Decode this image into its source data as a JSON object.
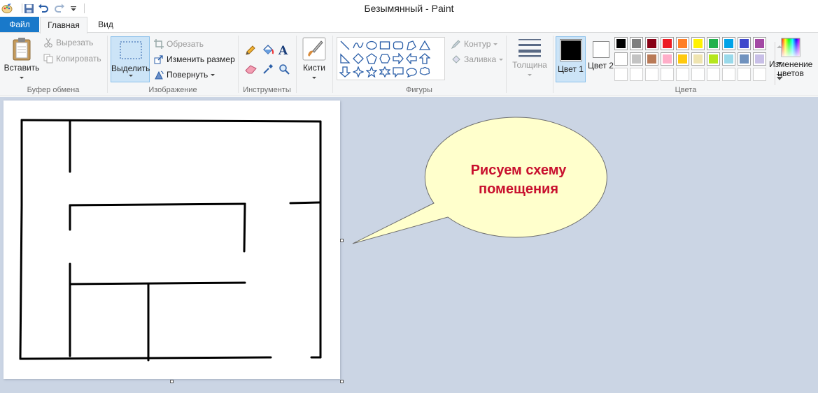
{
  "window": {
    "title": "Безымянный - Paint"
  },
  "tabs": {
    "file": "Файл",
    "home": "Главная",
    "view": "Вид"
  },
  "clipboard": {
    "paste": "Вставить",
    "cut": "Вырезать",
    "copy": "Копировать",
    "group": "Буфер обмена"
  },
  "image": {
    "select": "Выделить",
    "crop": "Обрезать",
    "resize": "Изменить размер",
    "rotate": "Повернуть",
    "group": "Изображение"
  },
  "tools": {
    "group": "Инструменты"
  },
  "brushes": {
    "label": "Кисти"
  },
  "shapes": {
    "outline": "Контур",
    "fill": "Заливка",
    "group": "Фигуры"
  },
  "size": {
    "label": "Толщина"
  },
  "colors": {
    "color1": "Цвет 1",
    "color2": "Цвет 2",
    "edit": "Изменение цветов",
    "group": "Цвета",
    "color1_value": "#000000",
    "color2_value": "#ffffff",
    "palette_row1": [
      "#000000",
      "#7f7f7f",
      "#880015",
      "#ed1c24",
      "#ff7f27",
      "#fff200",
      "#22b14c",
      "#00a2e8",
      "#3f48cc",
      "#a349a4"
    ],
    "palette_row2": [
      "#ffffff",
      "#c3c3c3",
      "#b97a57",
      "#ffaec9",
      "#ffc90e",
      "#efe4b0",
      "#b5e61d",
      "#99d9ea",
      "#7092be",
      "#c8bfe7"
    ]
  },
  "callout": {
    "line1": "Рисуем схему",
    "line2": "помещения",
    "text_color": "#c8102e",
    "fill_color": "#ffffcc"
  }
}
